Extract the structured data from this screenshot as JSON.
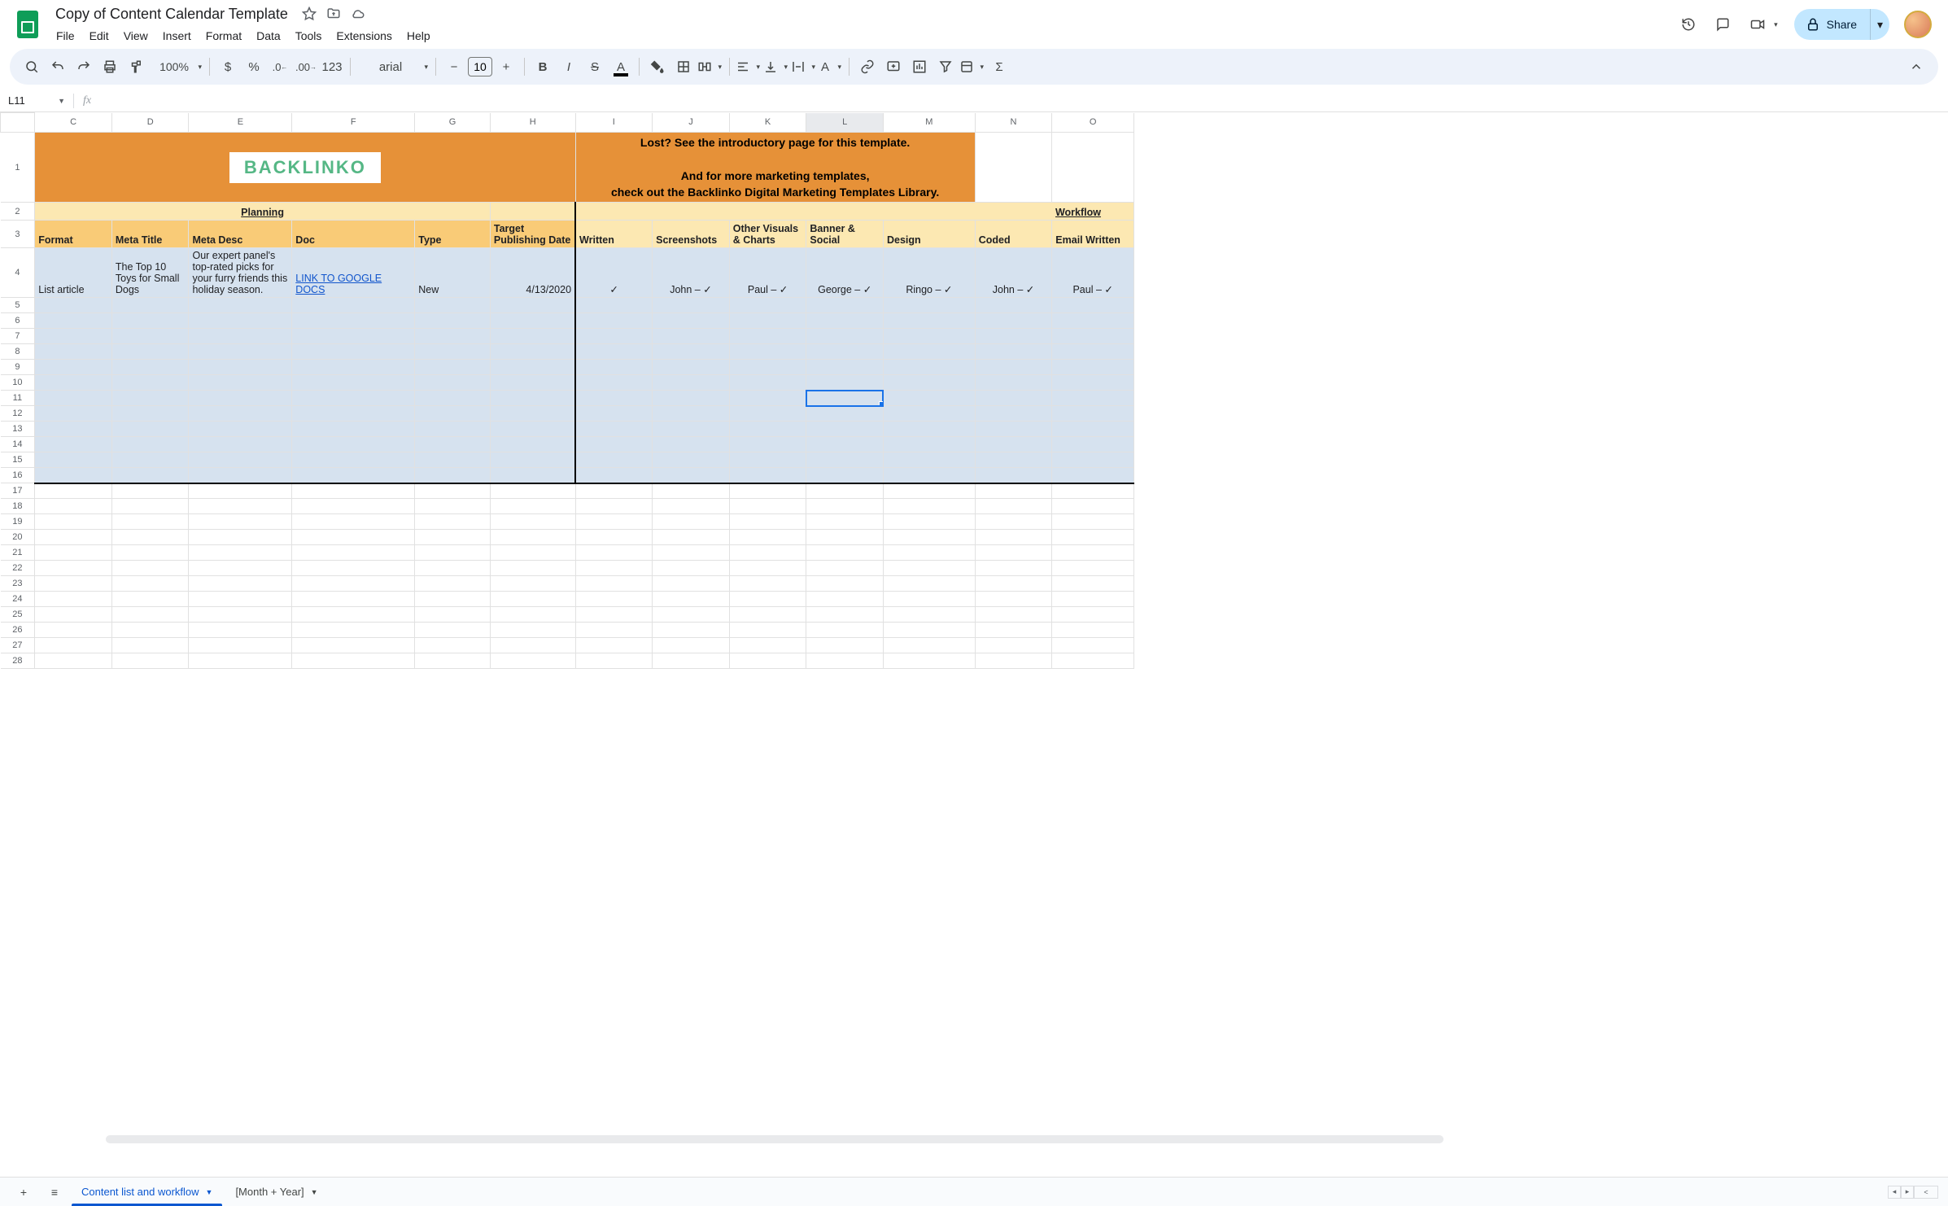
{
  "header": {
    "doc_title": "Copy of Content Calendar Template",
    "menu": [
      "File",
      "Edit",
      "View",
      "Insert",
      "Format",
      "Data",
      "Tools",
      "Extensions",
      "Help"
    ],
    "share_label": "Share"
  },
  "toolbar": {
    "zoom": "100%",
    "font_name": "arial",
    "font_size": "10"
  },
  "namebox": "L11",
  "formula": "",
  "columns": [
    "C",
    "D",
    "E",
    "F",
    "G",
    "H",
    "I",
    "J",
    "K",
    "L",
    "M",
    "N",
    "O"
  ],
  "section_headers": {
    "planning": "Planning",
    "workflow": "Workflow"
  },
  "field_headers": {
    "C": "Format",
    "D": "Meta Title",
    "E": "Meta Desc",
    "F": "Doc",
    "G": "Type",
    "H": "Target Publishing Date",
    "I": "Written",
    "J": "Screenshots",
    "K": "Other Visuals & Charts",
    "L": "Banner & Social",
    "M": "Design",
    "N": "Coded",
    "O": "Email Written"
  },
  "banner": {
    "brand": "BACKLINKO",
    "msg_line1": "Lost? See the introductory page for this template.",
    "msg_line2": "And for more marketing templates,",
    "msg_line3": "check out the Backlinko Digital Marketing Templates Library."
  },
  "data_row": {
    "C": "List article",
    "D": "The Top 10 Toys for Small Dogs",
    "E": "Our expert panel's top-rated picks for your furry friends this holiday season.",
    "F": "LINK TO GOOGLE DOCS",
    "G": "New",
    "H": "4/13/2020",
    "I": "✓",
    "J": "John – ✓",
    "K": "Paul – ✓",
    "L": "George –  ✓",
    "M": "Ringo – ✓",
    "N": "John – ✓",
    "O": "Paul – ✓"
  },
  "tabs": {
    "active": "Content list and workflow",
    "other": "[Month + Year]"
  },
  "selected": {
    "col": "L",
    "row": 11
  }
}
